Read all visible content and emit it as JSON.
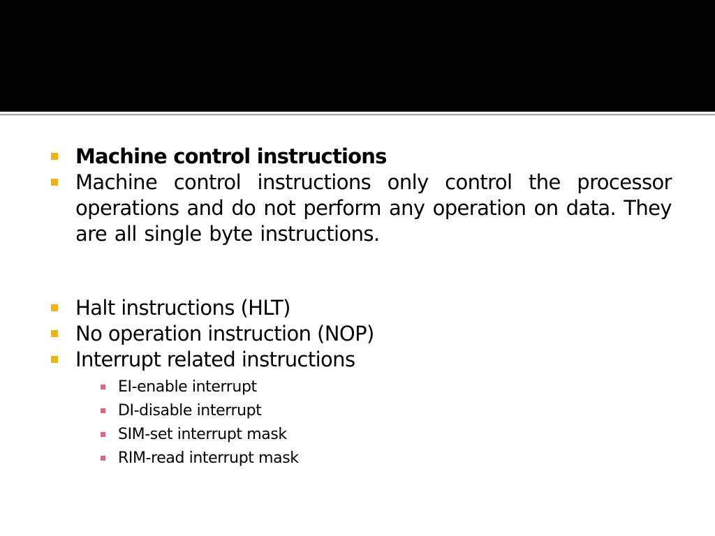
{
  "slide": {
    "bullets": [
      {
        "text": "Machine control instructions",
        "bold": true
      },
      {
        "text": "Machine control instructions only control the processor operations and do not perform any operation on data. They are all single byte instructions."
      },
      {
        "text": "Halt instructions (HLT)"
      },
      {
        "text": "No operation instruction (NOP)"
      },
      {
        "text": "Interrupt related instructions"
      }
    ],
    "sub_bullets": [
      {
        "text": "EI-enable interrupt"
      },
      {
        "text": "DI-disable interrupt"
      },
      {
        "text": "SIM-set interrupt mask"
      },
      {
        "text": "RIM-read interrupt mask"
      }
    ]
  },
  "colors": {
    "header_band": "#000000",
    "bullet_level1": "#f2b211",
    "bullet_level2": "#e0647e"
  }
}
